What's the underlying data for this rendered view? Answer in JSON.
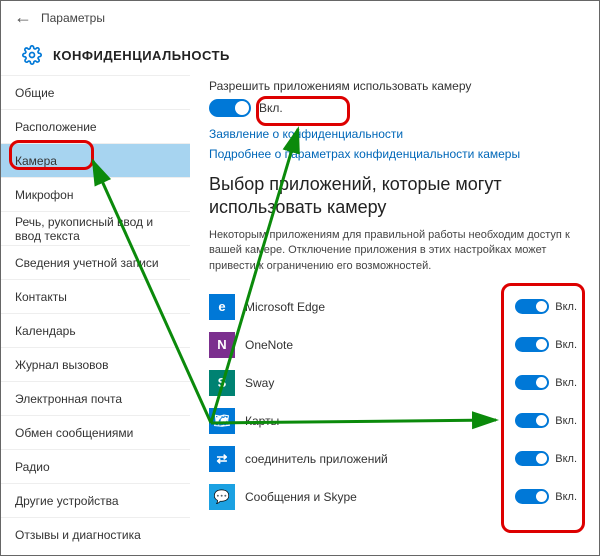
{
  "topbar": {
    "title": "Параметры"
  },
  "header": {
    "title": "КОНФИДЕНЦИАЛЬНОСТЬ"
  },
  "sidebar": {
    "items": [
      {
        "label": "Общие"
      },
      {
        "label": "Расположение"
      },
      {
        "label": "Камера",
        "selected": true
      },
      {
        "label": "Микрофон"
      },
      {
        "label": "Речь, рукописный ввод и ввод текста"
      },
      {
        "label": "Сведения учетной записи"
      },
      {
        "label": "Контакты"
      },
      {
        "label": "Календарь"
      },
      {
        "label": "Журнал вызовов"
      },
      {
        "label": "Электронная почта"
      },
      {
        "label": "Обмен сообщениями"
      },
      {
        "label": "Радио"
      },
      {
        "label": "Другие устройства"
      },
      {
        "label": "Отзывы и диагностика"
      }
    ]
  },
  "main": {
    "lead": "Разрешить приложениям использовать камеру",
    "master_toggle_label": "Вкл.",
    "link_privacy": "Заявление о конфиденциальности",
    "link_more": "Подробнее о параметрах конфиденциальности камеры",
    "section_title": "Выбор приложений, которые могут использовать камеру",
    "desc": "Некоторым приложениям для правильной работы необходим доступ к вашей камере. Отключение приложения в этих настройках может привести к ограничению его возможностей.",
    "apps": [
      {
        "name": "Microsoft Edge",
        "on": "Вкл.",
        "glyph": "e",
        "cls": "edge"
      },
      {
        "name": "OneNote",
        "on": "Вкл.",
        "glyph": "N",
        "cls": "onenote"
      },
      {
        "name": "Sway",
        "on": "Вкл.",
        "glyph": "S",
        "cls": "sway"
      },
      {
        "name": "Карты",
        "on": "Вкл.",
        "glyph": "🗺",
        "cls": "maps"
      },
      {
        "name": "соединитель приложений",
        "on": "Вкл.",
        "glyph": "⇄",
        "cls": "conn"
      },
      {
        "name": "Сообщения и Skype",
        "on": "Вкл.",
        "glyph": "💬",
        "cls": "skype"
      }
    ]
  }
}
